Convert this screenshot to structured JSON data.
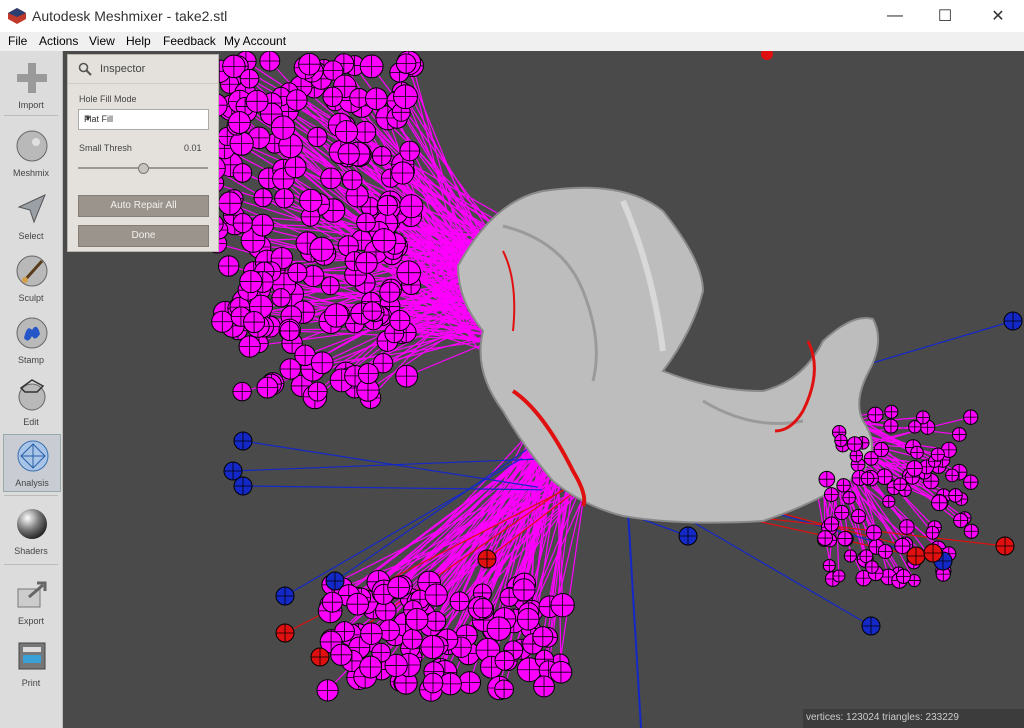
{
  "window": {
    "title": "Autodesk Meshmixer - take2.stl"
  },
  "menu": [
    "File",
    "Actions",
    "View",
    "Help",
    "Feedback",
    "My Account"
  ],
  "tools": [
    {
      "label": "Import",
      "icon": "plus-icon"
    },
    {
      "label": "Meshmix",
      "icon": "meshmix-icon"
    },
    {
      "label": "Select",
      "icon": "select-arrow-icon"
    },
    {
      "label": "Sculpt",
      "icon": "brush-icon"
    },
    {
      "label": "Stamp",
      "icon": "stamp-icon"
    },
    {
      "label": "Edit",
      "icon": "edit-sphere-icon"
    },
    {
      "label": "Analysis",
      "icon": "analysis-icon",
      "active": true
    },
    {
      "label": "Shaders",
      "icon": "shader-sphere-icon"
    },
    {
      "label": "Export",
      "icon": "export-icon"
    },
    {
      "label": "Print",
      "icon": "printer-icon"
    }
  ],
  "inspector": {
    "title": "Inspector",
    "hole_fill_label": "Hole Fill Mode",
    "hole_fill_value": "Flat Fill",
    "small_thresh_label": "Small Thresh",
    "small_thresh_value": "0.01",
    "auto_repair_label": "Auto Repair All",
    "done_label": "Done"
  },
  "status": {
    "text": "vertices: 123024 triangles: 233229"
  },
  "colors": {
    "viewport_bg": "#4a4a4a",
    "marker_magenta": "#ff00ff",
    "marker_blue": "#1428c8",
    "marker_red": "#e01010",
    "mesh": "#bdbdbd"
  }
}
